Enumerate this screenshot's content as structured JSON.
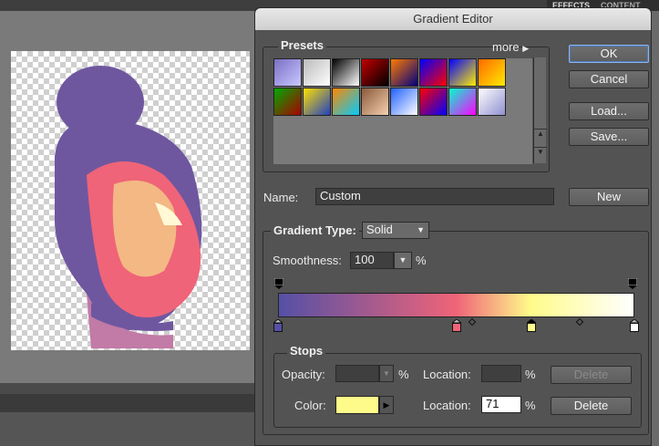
{
  "panel_tabs": [
    "EFFECTS",
    "CONTENT"
  ],
  "dialog": {
    "title": "Gradient Editor",
    "presets_label": "Presets",
    "more_label": "more",
    "buttons": {
      "ok": "OK",
      "cancel": "Cancel",
      "load": "Load...",
      "save": "Save...",
      "new": "New"
    },
    "name_label": "Name:",
    "name_value": "Custom",
    "gradient_type_label": "Gradient Type:",
    "gradient_type_value": "Solid",
    "smoothness_label": "Smoothness:",
    "smoothness_value": "100",
    "percent": "%",
    "stops_label": "Stops",
    "opacity_label": "Opacity:",
    "opacity_value": "",
    "location_label": "Location:",
    "opacity_location_value": "",
    "delete_label": "Delete",
    "color_label": "Color:",
    "color_location_value": "71",
    "selected_color": "#fffb8a"
  },
  "presets": [
    [
      "#7c6fc4",
      "#c8c8ff"
    ],
    [
      "#bbbbbb",
      "#ffffff"
    ],
    [
      "#000000",
      "#ffffff"
    ],
    [
      "#c00000",
      "#000000"
    ],
    [
      "#ff7a00",
      "#000080"
    ],
    [
      "#0000ff",
      "#ff0000"
    ],
    [
      "#0000ff",
      "#ffee00"
    ],
    [
      "#ff6a00",
      "#ffea00"
    ],
    [
      "#00aa00",
      "#aa0000"
    ],
    [
      "#ffe000",
      "#2040c0"
    ],
    [
      "#ff8800",
      "#00ccff"
    ],
    [
      "#8a5a3a",
      "#f5d0b0"
    ],
    [
      "#2060ff",
      "#ffffff"
    ],
    [
      "#ff0000",
      "#0000ff"
    ],
    [
      "#00ffcc",
      "#ff00ff"
    ],
    [
      "#ffffff",
      "#9090d0"
    ]
  ],
  "gradient_stops": [
    {
      "location": 0,
      "color": "#5550a5"
    },
    {
      "location": 50,
      "color": "#ef6478"
    },
    {
      "location": 71,
      "color": "#fffb8a"
    },
    {
      "location": 100,
      "color": "#ffffff"
    }
  ]
}
